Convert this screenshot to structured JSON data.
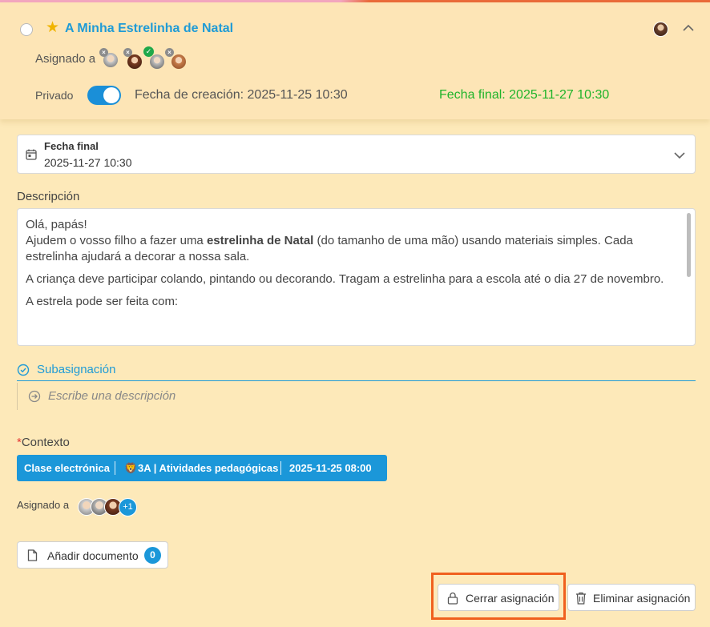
{
  "header": {
    "title": "A Minha Estrelinha de Natal",
    "assigned_label": "Asignado a",
    "assignees": [
      {
        "status": "removed"
      },
      {
        "status": "removed"
      },
      {
        "status": "completed"
      },
      {
        "status": "removed"
      }
    ],
    "privado_label": "Privado",
    "privado_on": true,
    "fecha_creacion": "Fecha de creación: 2025-11-25 10:30",
    "fecha_final": "Fecha final: 2025-11-27 10:30"
  },
  "due_date": {
    "label": "Fecha final",
    "value": "2025-11-27 10:30"
  },
  "description": {
    "label": "Descripción",
    "line1": "Olá, papás!",
    "line2_pre": "Ajudem o vosso filho a fazer uma ",
    "line2_bold": "estrelinha de Natal",
    "line2_post": " (do tamanho de uma mão) usando materiais simples. Cada estrelinha ajudará a decorar a nossa sala.",
    "para2": "A criança deve participar colando, pintando ou decorando. Tragam a estrelinha para a escola até o dia 27 de novembro.",
    "para3": "A estrela pode ser feita com:"
  },
  "subassignment": {
    "label": "Subasignación",
    "placeholder": "Escribe una descripción"
  },
  "context": {
    "label": "Contexto",
    "required_mark": "*",
    "chip_course": "Clase electrónica",
    "chip_emoji": "🦁",
    "chip_class": "3A | Atividades pedagógicas",
    "chip_date": "2025-11-25 08:00"
  },
  "assigned2": {
    "label": "Asignado a",
    "extra_count": "+1"
  },
  "documents": {
    "add_label": "Añadir documento",
    "count": "0"
  },
  "actions": {
    "close_label": "Cerrar asignación",
    "delete_label": "Eliminar asignación"
  },
  "colors": {
    "accent": "#1b97d9",
    "success": "#1fb42a",
    "background": "#fde9b9",
    "highlight": "#f0601e"
  }
}
